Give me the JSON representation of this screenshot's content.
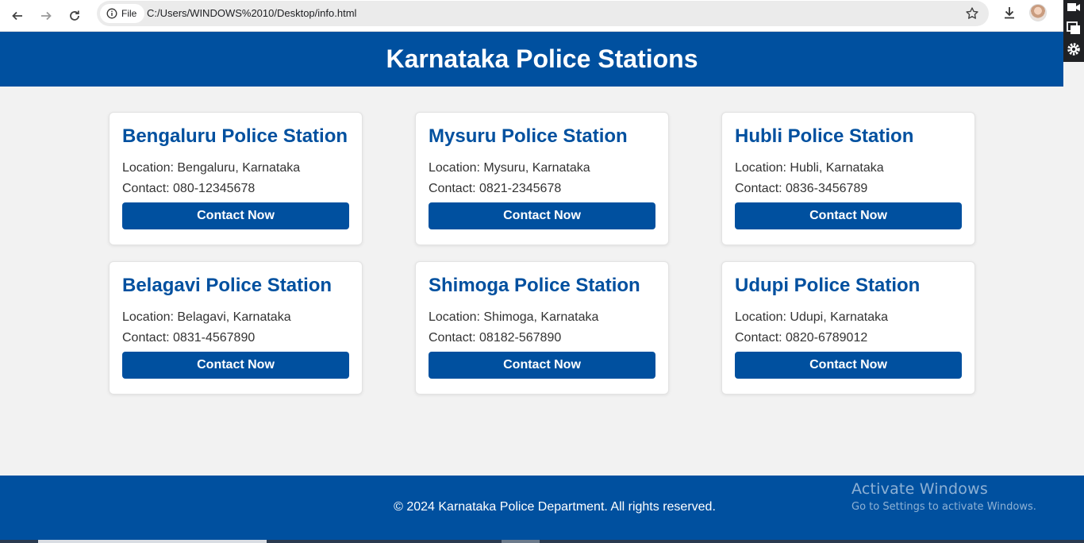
{
  "browser": {
    "chip_label": "File",
    "url": "C:/Users/WINDOWS%2010/Desktop/info.html"
  },
  "header": {
    "title": "Karnataka Police Stations"
  },
  "stations": [
    {
      "name": "Bengaluru Police Station",
      "location": "Location: Bengaluru, Karnataka",
      "contact": "Contact: 080-12345678",
      "button": "Contact Now"
    },
    {
      "name": "Mysuru Police Station",
      "location": "Location: Mysuru, Karnataka",
      "contact": "Contact: 0821-2345678",
      "button": "Contact Now"
    },
    {
      "name": "Hubli Police Station",
      "location": "Location: Hubli, Karnataka",
      "contact": "Contact: 0836-3456789",
      "button": "Contact Now"
    },
    {
      "name": "Belagavi Police Station",
      "location": "Location: Belagavi, Karnataka",
      "contact": "Contact: 0831-4567890",
      "button": "Contact Now"
    },
    {
      "name": "Shimoga Police Station",
      "location": "Location: Shimoga, Karnataka",
      "contact": "Contact: 08182-567890",
      "button": "Contact Now"
    },
    {
      "name": "Udupi Police Station",
      "location": "Location: Udupi, Karnataka",
      "contact": "Contact: 0820-6789012",
      "button": "Contact Now"
    }
  ],
  "footer": {
    "copyright": "© 2024 Karnataka Police Department. All rights reserved."
  },
  "watermark": {
    "line1": "Activate Windows",
    "line2": "Go to Settings to activate Windows."
  },
  "colors": {
    "brand": "#00509f",
    "background": "#f2f2f2"
  },
  "icons": [
    "back-arrow-icon",
    "forward-arrow-icon",
    "reload-icon",
    "info-icon",
    "star-icon",
    "download-icon",
    "video-icon",
    "window-icon",
    "gear-icon"
  ]
}
